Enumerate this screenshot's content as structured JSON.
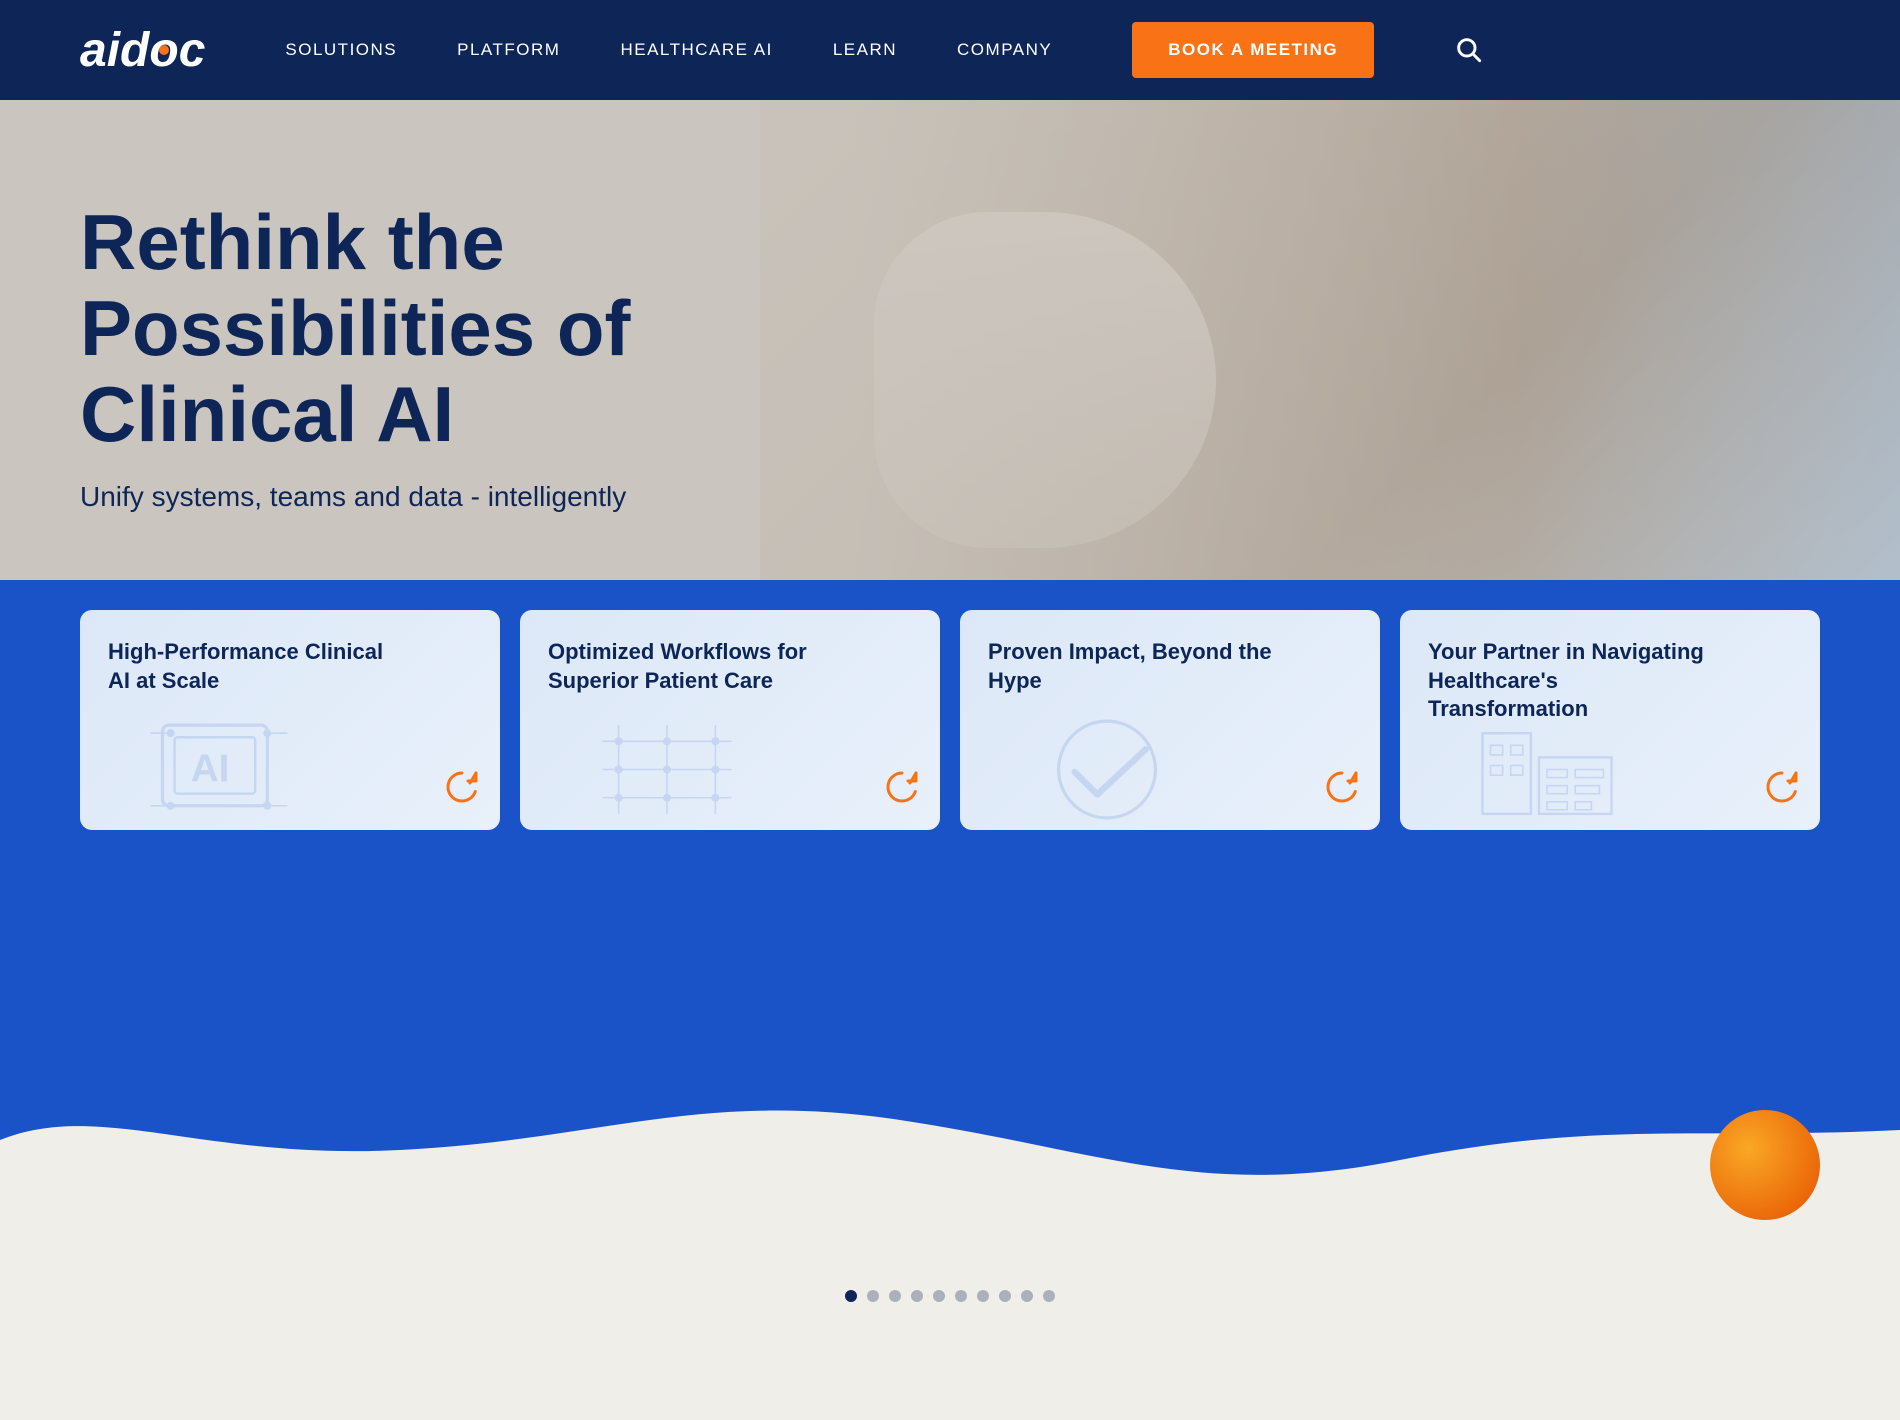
{
  "navbar": {
    "logo_text": "aidoc",
    "nav_items": [
      {
        "label": "SOLUTIONS",
        "id": "solutions"
      },
      {
        "label": "PLATFORM",
        "id": "platform"
      },
      {
        "label": "HEALTHCARE AI",
        "id": "healthcare-ai"
      },
      {
        "label": "LEARN",
        "id": "learn"
      },
      {
        "label": "COMPANY",
        "id": "company"
      }
    ],
    "cta_label": "BOOK A MEETING"
  },
  "hero": {
    "title_line1": "Rethink the",
    "title_line2": "Possibilities of Clinical AI",
    "subtitle": "Unify systems, teams and data - intelligently"
  },
  "cards": [
    {
      "id": "card-1",
      "title": "High-Performance Clinical AI at Scale",
      "icon": "ai-icon",
      "bg_type": "ai"
    },
    {
      "id": "card-2",
      "title": "Optimized Workflows for Superior Patient Care",
      "icon": "circuit-icon",
      "bg_type": "circuit"
    },
    {
      "id": "card-3",
      "title": "Proven Impact, Beyond the Hype",
      "icon": "check-icon",
      "bg_type": "check"
    },
    {
      "id": "card-4",
      "title": "Your Partner in Navigating Healthcare's Transformation",
      "icon": "building-icon",
      "bg_type": "building"
    }
  ],
  "dots": {
    "count": 10,
    "active_index": 0
  },
  "colors": {
    "navy": "#0d2557",
    "blue": "#1a52c8",
    "orange": "#f97316",
    "white": "#ffffff"
  }
}
